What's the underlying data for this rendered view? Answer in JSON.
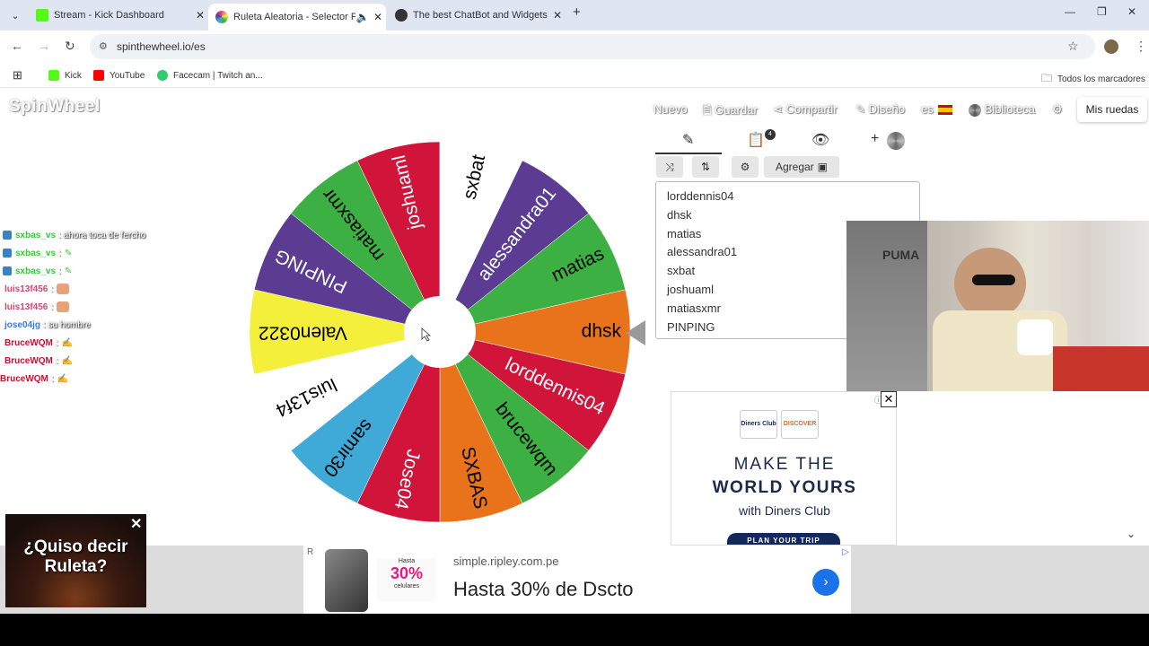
{
  "browser": {
    "tabs": [
      {
        "title": "Stream - Kick Dashboard",
        "favicon_color": "#53fc18",
        "active": false
      },
      {
        "title": "Ruleta Aleatoria - Selector P",
        "favicon_color": "#e84b8a",
        "active": true
      },
      {
        "title": "The best ChatBot and Widgets",
        "favicon_color": "#333333",
        "active": false
      }
    ],
    "url": "spinthewheel.io/es",
    "bookmarks": [
      {
        "label": "Kick",
        "color": "#53fc18"
      },
      {
        "label": "YouTube",
        "color": "#ff0000"
      },
      {
        "label": "Facecam | Twitch an...",
        "color": "#2ecc71"
      }
    ],
    "all_bookmarks": "Todos los marcadores"
  },
  "site": {
    "logo": "SpinWheel",
    "menu": [
      "Nuevo",
      "Guardar",
      "Compartir",
      "Diseño",
      "es",
      "Biblioteca"
    ],
    "mis_ruedas": "Mis ruedas",
    "agregar": "Agregar",
    "entries": [
      "lorddennis04",
      "dhsk",
      "matias",
      "alessandra01",
      "sxbat",
      "joshuaml",
      "matiasxmr",
      "PINPING"
    ]
  },
  "wheel": {
    "segments": [
      {
        "label": "dhsk",
        "color": "#e8731a",
        "text_color": "#000000"
      },
      {
        "label": "lorddennis04",
        "color": "#d0143a",
        "text_color": "#ffffff"
      },
      {
        "label": "brucewqm",
        "color": "#3cb043",
        "text_color": "#000000"
      },
      {
        "label": "SXBAS",
        "color": "#e8731a",
        "text_color": "#000000"
      },
      {
        "label": "Jose04",
        "color": "#d0143a",
        "text_color": "#ffffff"
      },
      {
        "label": "samir30",
        "color": "#3fa9d8",
        "text_color": "#000000"
      },
      {
        "label": "luis13f4",
        "color": "#ffffff",
        "text_color": "#000000"
      },
      {
        "label": "Valen0322",
        "color": "#f3ef3a",
        "text_color": "#000000"
      },
      {
        "label": "PINPING",
        "color": "#5b3c92",
        "text_color": "#ffffff"
      },
      {
        "label": "matiasxmr",
        "color": "#3cb043",
        "text_color": "#000000"
      },
      {
        "label": "joshuaml",
        "color": "#d0143a",
        "text_color": "#ffffff"
      },
      {
        "label": "sxbat",
        "color": "#ffffff",
        "text_color": "#000000"
      },
      {
        "label": "alessandra01",
        "color": "#5b3c92",
        "text_color": "#ffffff"
      },
      {
        "label": "matias",
        "color": "#3cb043",
        "text_color": "#000000"
      }
    ]
  },
  "chat": [
    {
      "user": "sxbas_vs",
      "color": "#3cc43c",
      "msg": ": ahora toca de fercho"
    },
    {
      "user": "sxbas_vs",
      "color": "#3cc43c",
      "msg": ":"
    },
    {
      "user": "sxbas_vs",
      "color": "#3cc43c",
      "msg": ":"
    },
    {
      "user": "luis13f456",
      "color": "#d04870",
      "msg": ":"
    },
    {
      "user": "luis13f456",
      "color": "#d04870",
      "msg": ":"
    },
    {
      "user": "jose04jg",
      "color": "#3b7ad9",
      "msg": ": su hombre"
    },
    {
      "user": "BruceWQM",
      "color": "#c8102e",
      "msg": ":"
    },
    {
      "user": "BruceWQM",
      "color": "#c8102e",
      "msg": ":"
    },
    {
      "user": "BruceWQM",
      "color": "#c8102e",
      "msg": ":"
    }
  ],
  "ads": {
    "right": {
      "card1": "Diners Club",
      "card2": "DISCOVER",
      "line1": "MAKE THE",
      "line2": "WORLD YOURS",
      "line3": "with Diners Club",
      "cta": "PLAN YOUR TRIP"
    },
    "bottom": {
      "promo_top": "Hasta",
      "promo_num": "30%",
      "promo_sub": "celulares",
      "domain": "simple.ripley.com.pe",
      "headline": "Hasta 30% de Dscto"
    },
    "roulette": "¿Quiso decir Ruleta?"
  }
}
